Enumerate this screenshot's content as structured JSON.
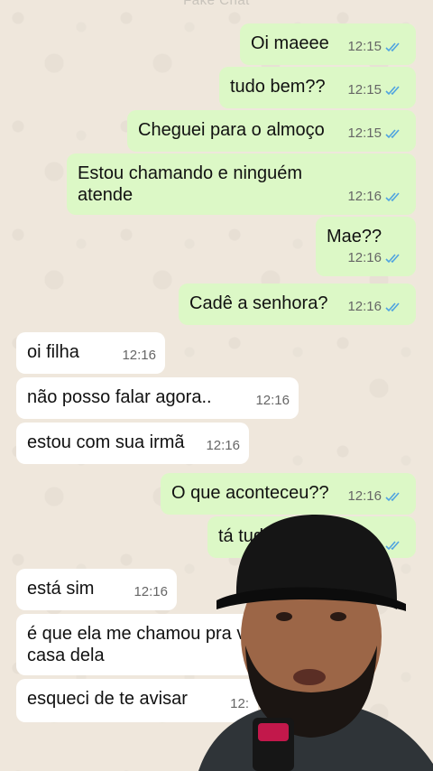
{
  "header": {
    "title": "Fake Chat"
  },
  "messages": [
    {
      "dir": "out",
      "text": "Oi maeee",
      "time": "12:15",
      "read": true
    },
    {
      "dir": "out",
      "text": "tudo bem??",
      "time": "12:15",
      "read": true
    },
    {
      "dir": "out",
      "text": "Cheguei para o almoço",
      "time": "12:15",
      "read": true
    },
    {
      "dir": "out",
      "text": "Estou chamando e ninguém\natende",
      "time": "12:16",
      "read": true
    },
    {
      "dir": "out",
      "text": "Mae??",
      "time": "12:16",
      "read": true
    },
    {
      "dir": "out",
      "text": "Cadê a senhora?",
      "time": "12:16",
      "read": true
    },
    {
      "dir": "in",
      "text": "oi filha",
      "time": "12:16"
    },
    {
      "dir": "in",
      "text": "não posso falar agora..",
      "time": "12:16"
    },
    {
      "dir": "in",
      "text": "estou com sua irmã",
      "time": "12:16"
    },
    {
      "dir": "out",
      "text": "O que aconteceu??",
      "time": "12:16",
      "read": true
    },
    {
      "dir": "out",
      "text": "tá tudo",
      "time": "",
      "read": true
    },
    {
      "dir": "in",
      "text": "está sim",
      "time": "12:16"
    },
    {
      "dir": "in",
      "text": "é que ela me chamou pra vir\ncasa dela",
      "time": ""
    },
    {
      "dir": "in",
      "text": "esqueci de te avisar",
      "time": "12:"
    }
  ],
  "colors": {
    "outgoing_bubble": "#dcf8c6",
    "incoming_bubble": "#ffffff",
    "read_ticks": "#4fa3e0",
    "wallpaper": "#efe7dc"
  },
  "overlay": {
    "icon": "webcam-person-overlay"
  }
}
